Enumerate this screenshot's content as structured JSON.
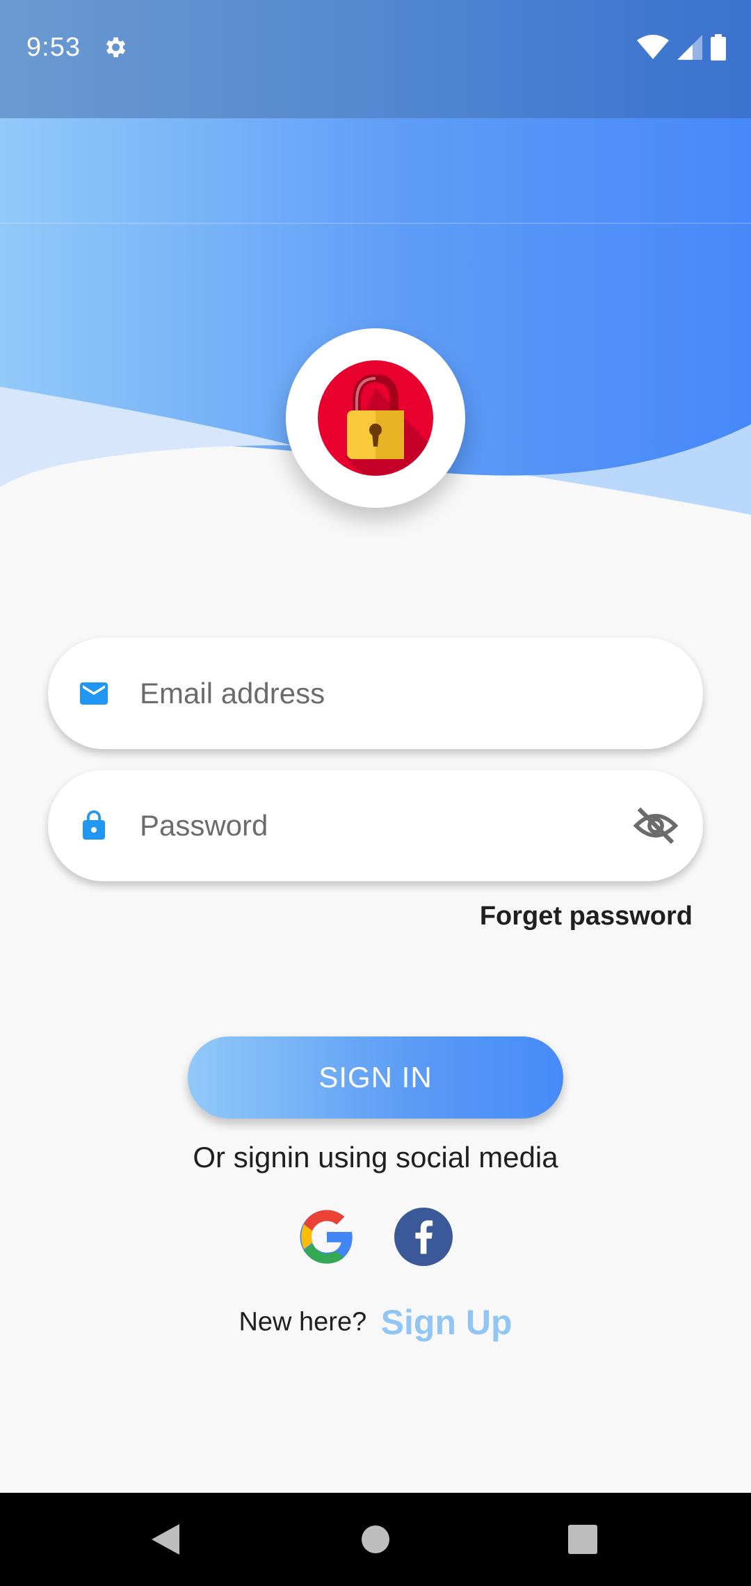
{
  "status_bar": {
    "time": "9:53",
    "icons": [
      "gear-icon",
      "wifi-icon",
      "cell-signal-icon",
      "battery-icon"
    ]
  },
  "logo": {
    "icon": "padlock-icon"
  },
  "login_form": {
    "email": {
      "icon": "mail-icon",
      "placeholder": "Email address",
      "value": ""
    },
    "password": {
      "icon": "lock-icon",
      "placeholder": "Password",
      "value": "",
      "toggle_icon": "eye-off-icon"
    },
    "forget_password_label": "Forget password",
    "sign_in_label": "SIGN IN"
  },
  "social": {
    "prompt": "Or signin using social media",
    "providers": [
      "google-icon",
      "facebook-icon"
    ]
  },
  "signup": {
    "prompt": "New here?",
    "link_label": "Sign Up"
  },
  "nav_bar": {
    "buttons": [
      "back-icon",
      "home-icon",
      "recents-icon"
    ]
  },
  "colors": {
    "accent_blue": "#468bf8",
    "light_blue": "#90c5f4",
    "input_icon_blue": "#2196f3",
    "lock_red": "#e8002f",
    "lock_yellow": "#f8c93a"
  }
}
